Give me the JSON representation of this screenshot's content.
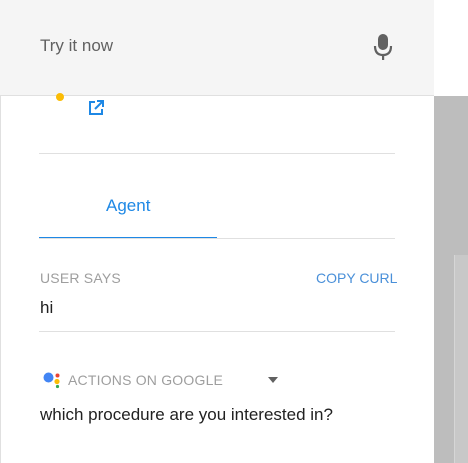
{
  "header": {
    "title": "Try it now",
    "mic_icon": "microphone-icon"
  },
  "link_icon": "external-link-icon",
  "tabs": [
    {
      "label": "Agent",
      "active": true
    }
  ],
  "user_says": {
    "label": "USER SAYS",
    "copy_label": "COPY CURL",
    "text": "hi"
  },
  "response": {
    "source_label": "ACTIONS ON GOOGLE",
    "source_icon": "google-assistant-icon",
    "text": "which procedure are you interested in?"
  },
  "colors": {
    "accent": "#1e88e5",
    "link": "#4a90d9",
    "label": "#9e9e9e"
  }
}
